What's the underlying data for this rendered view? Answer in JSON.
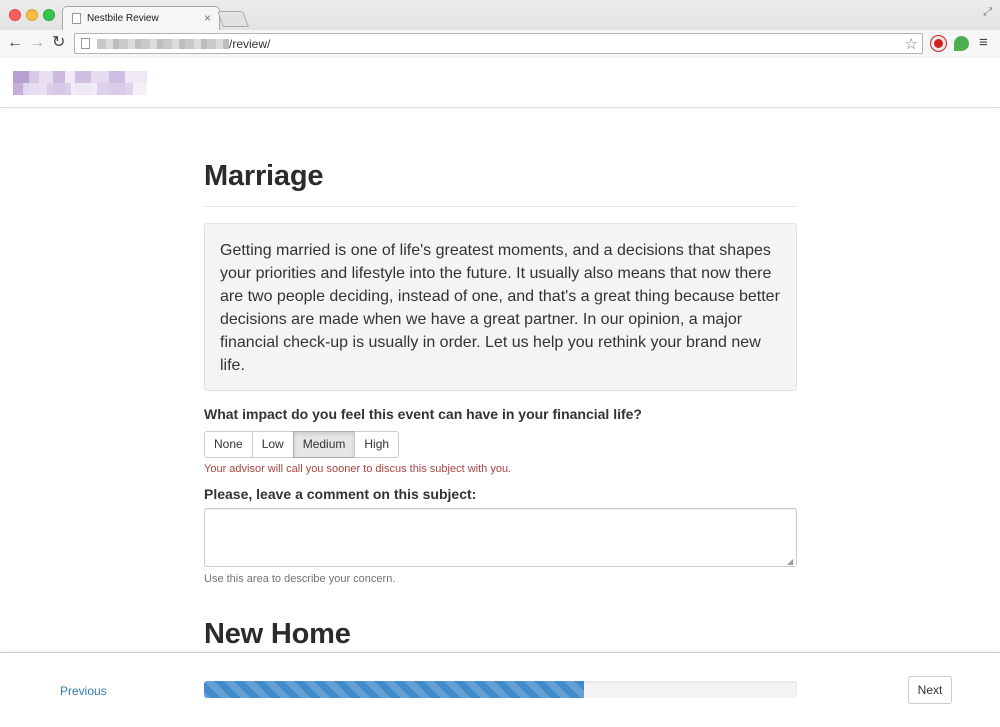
{
  "browser": {
    "tab_title": "Nestbile Review",
    "tab_close": "×",
    "url_path": "/review/",
    "fullscreen_glyph": "⤢",
    "back_glyph": "←",
    "forward_glyph": "→",
    "reload_glyph": "↻",
    "star_glyph": "☆",
    "menu_glyph": "≡"
  },
  "sections": [
    {
      "title": "Marriage",
      "description": "Getting married is one of life's greatest moments, and a decisions that shapes your priorities and lifestyle into the future. It usually also means that now there are two people deciding, instead of one, and that's a great thing because better decisions are made when we have a great partner. In our opinion, a major financial check-up is usually in order. Let us help you rethink your brand new life.",
      "question": "What impact do you feel this event can have in your financial life?",
      "options": [
        "None",
        "Low",
        "Medium",
        "High"
      ],
      "selected_option": "Medium",
      "advisor_note": "Your advisor will call you sooner to discus this subject with you.",
      "comment_label": "Please, leave a comment on this subject:",
      "comment_value": "",
      "comment_help": "Use this area to describe your concern."
    },
    {
      "title": "New Home"
    }
  ],
  "footer": {
    "previous_label": "Previous",
    "next_label": "Next",
    "progress_percent": 64
  },
  "colors": {
    "progress": "#428bca",
    "link": "#337ab7",
    "warning_text": "#a94442"
  }
}
